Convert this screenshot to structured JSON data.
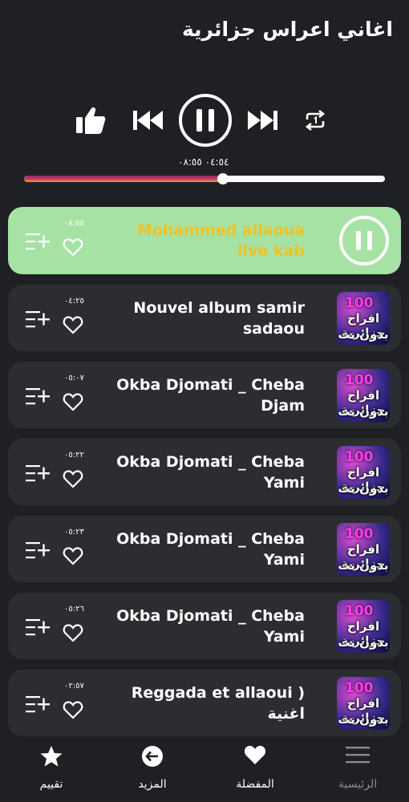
{
  "header": {
    "title": "اغاني اعراس جزائرية"
  },
  "player": {
    "time_readout": "٠٤:٥٤ ٠٨:٥٥",
    "progress": 0.55
  },
  "tracks": [
    {
      "title": "Mohammed allaoua live kab",
      "duration": "٠٨:٥٥",
      "active": true
    },
    {
      "title": "Nouvel album samir sadaou",
      "duration": "٠٤:٢٥"
    },
    {
      "title": "Okba Djomati _ Cheba Djam",
      "duration": "٠٥:٠٧"
    },
    {
      "title": "Okba Djomati _ Cheba Yami",
      "duration": "٠٥:٢٢"
    },
    {
      "title": "Okba Djomati _ Cheba Yami",
      "duration": "٠٥:٢٣"
    },
    {
      "title": "Okba Djomati _ Cheba Yami",
      "duration": "٠٥:٢٦"
    },
    {
      "title": "Reggada et allaoui ) اغنية",
      "duration": "٠٢:٥٧"
    }
  ],
  "thumb": {
    "top": "100",
    "line1": "افراح جزائرية",
    "line2": "بدون نت"
  },
  "nav": {
    "home": "الرئيسية",
    "favorites": "المفضلة",
    "more": "المزيد",
    "rate": "تقييم"
  },
  "colors": {
    "accent": "#a6e2a4",
    "active_title": "#f0c225",
    "row_bg": "#2b2d31",
    "bg": "#1f2023"
  }
}
